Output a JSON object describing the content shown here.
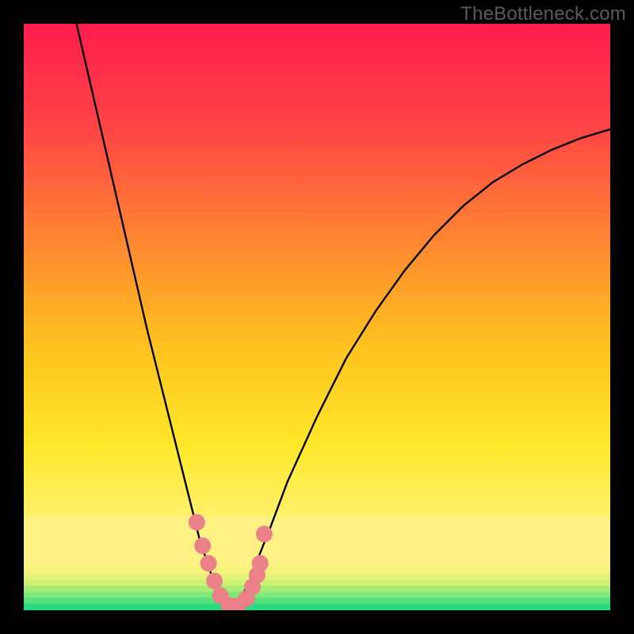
{
  "watermark": "TheBottleneck.com",
  "chart_data": {
    "type": "line",
    "title": "",
    "xlabel": "",
    "ylabel": "",
    "xlim": [
      0,
      100
    ],
    "ylim": [
      0,
      100
    ],
    "series": [
      {
        "name": "curve-left",
        "x": [
          9,
          12,
          15,
          18,
          21,
          23,
          25,
          27,
          29,
          30,
          31,
          32,
          33,
          34,
          35
        ],
        "y": [
          100,
          87,
          74,
          61,
          48,
          40,
          32,
          24,
          16,
          12,
          9,
          6,
          4,
          2,
          0
        ]
      },
      {
        "name": "curve-right",
        "x": [
          35,
          36,
          37,
          38,
          39,
          40,
          42,
          45,
          50,
          55,
          60,
          65,
          70,
          75,
          80,
          85,
          90,
          95,
          100
        ],
        "y": [
          0,
          1,
          2,
          4,
          6,
          9,
          14,
          22,
          33,
          43,
          51,
          58,
          64,
          69,
          73,
          76,
          78.5,
          80.5,
          82
        ]
      }
    ],
    "markers": {
      "name": "highlight-dots",
      "color": "#ea8088",
      "points": [
        {
          "x": 29.5,
          "y": 15
        },
        {
          "x": 30.5,
          "y": 11
        },
        {
          "x": 31.5,
          "y": 8
        },
        {
          "x": 32.5,
          "y": 5
        },
        {
          "x": 33.5,
          "y": 2.5
        },
        {
          "x": 35,
          "y": 0.8
        },
        {
          "x": 36.5,
          "y": 0.8
        },
        {
          "x": 38,
          "y": 2
        },
        {
          "x": 39,
          "y": 4
        },
        {
          "x": 39.8,
          "y": 6
        },
        {
          "x": 40.3,
          "y": 8
        },
        {
          "x": 41,
          "y": 13
        }
      ]
    },
    "bands": [
      {
        "name": "green-1",
        "y0": 0,
        "y1": 1.2,
        "color": "#2bdc7f"
      },
      {
        "name": "green-2",
        "y0": 1.2,
        "y1": 2.2,
        "color": "#55e27a"
      },
      {
        "name": "green-3",
        "y0": 2.2,
        "y1": 3.2,
        "color": "#7fe876"
      },
      {
        "name": "green-4",
        "y0": 3.2,
        "y1": 4.2,
        "color": "#a7ed74"
      },
      {
        "name": "green-5",
        "y0": 4.2,
        "y1": 5.2,
        "color": "#ccf174"
      },
      {
        "name": "green-6",
        "y0": 5.2,
        "y1": 6.2,
        "color": "#e5f278"
      },
      {
        "name": "green-7",
        "y0": 6.2,
        "y1": 7.5,
        "color": "#f3f27a"
      },
      {
        "name": "yellow-band",
        "y0": 7.5,
        "y1": 16,
        "color": "#fff284"
      }
    ],
    "gradient": {
      "stops": [
        {
          "offset": 0,
          "color": "#ff1c4e"
        },
        {
          "offset": 0.18,
          "color": "#ff4545"
        },
        {
          "offset": 0.38,
          "color": "#ff8a30"
        },
        {
          "offset": 0.55,
          "color": "#ffc21e"
        },
        {
          "offset": 0.72,
          "color": "#ffe82a"
        },
        {
          "offset": 0.84,
          "color": "#fff06a"
        },
        {
          "offset": 1.0,
          "color": "#fff284"
        }
      ]
    }
  }
}
